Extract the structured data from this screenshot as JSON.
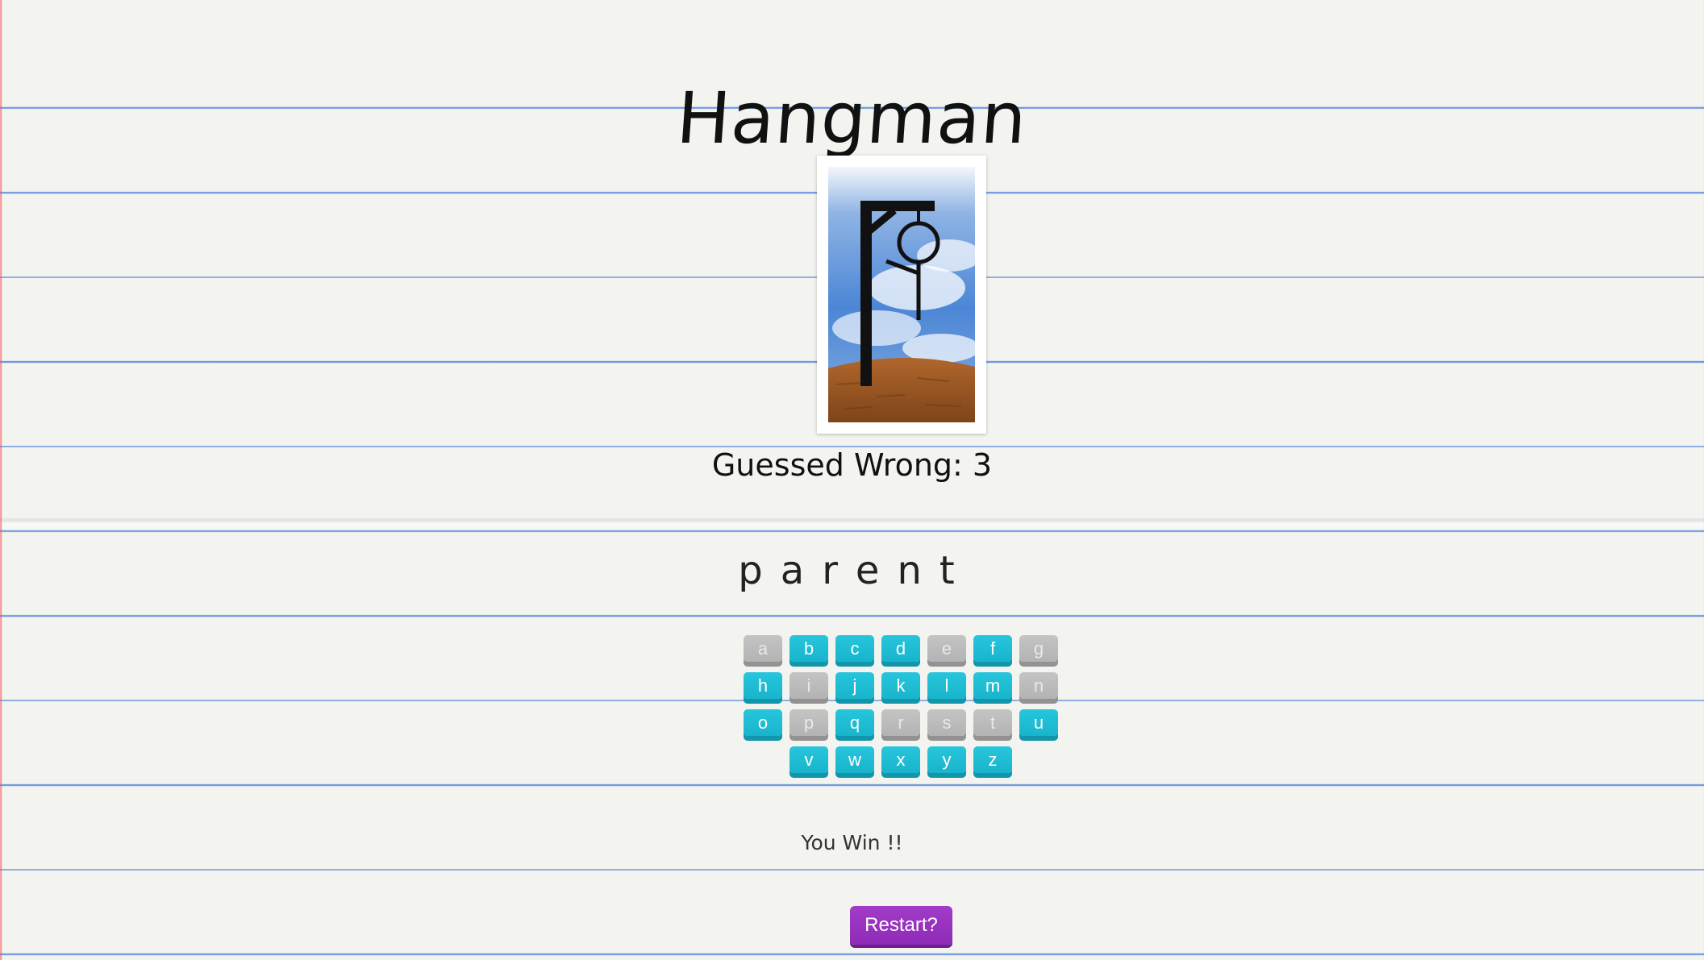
{
  "game": {
    "title": "Hangman",
    "wrong_label": "Guessed Wrong: 3",
    "word_letters": [
      "p",
      "a",
      "r",
      "e",
      "n",
      "t"
    ],
    "message": "You Win !!",
    "restart_label": "Restart?"
  },
  "keyboard": {
    "rows": [
      [
        {
          "letter": "a",
          "state": "used"
        },
        {
          "letter": "b",
          "state": "active"
        },
        {
          "letter": "c",
          "state": "active"
        },
        {
          "letter": "d",
          "state": "active"
        },
        {
          "letter": "e",
          "state": "used"
        },
        {
          "letter": "f",
          "state": "active"
        },
        {
          "letter": "g",
          "state": "used"
        }
      ],
      [
        {
          "letter": "h",
          "state": "active"
        },
        {
          "letter": "i",
          "state": "used"
        },
        {
          "letter": "j",
          "state": "active"
        },
        {
          "letter": "k",
          "state": "active"
        },
        {
          "letter": "l",
          "state": "active"
        },
        {
          "letter": "m",
          "state": "active"
        },
        {
          "letter": "n",
          "state": "used"
        }
      ],
      [
        {
          "letter": "o",
          "state": "active"
        },
        {
          "letter": "p",
          "state": "used"
        },
        {
          "letter": "q",
          "state": "active"
        },
        {
          "letter": "r",
          "state": "used"
        },
        {
          "letter": "s",
          "state": "used"
        },
        {
          "letter": "t",
          "state": "used"
        },
        {
          "letter": "u",
          "state": "active"
        }
      ],
      [
        {
          "letter": "v",
          "state": "active"
        },
        {
          "letter": "w",
          "state": "active"
        },
        {
          "letter": "x",
          "state": "active"
        },
        {
          "letter": "y",
          "state": "active"
        },
        {
          "letter": "z",
          "state": "active"
        }
      ]
    ]
  },
  "colors": {
    "key_active": "#1bbcd3",
    "key_used": "#b9b9b9",
    "restart": "#9a33c0",
    "paper_line": "#5a8cdc"
  }
}
